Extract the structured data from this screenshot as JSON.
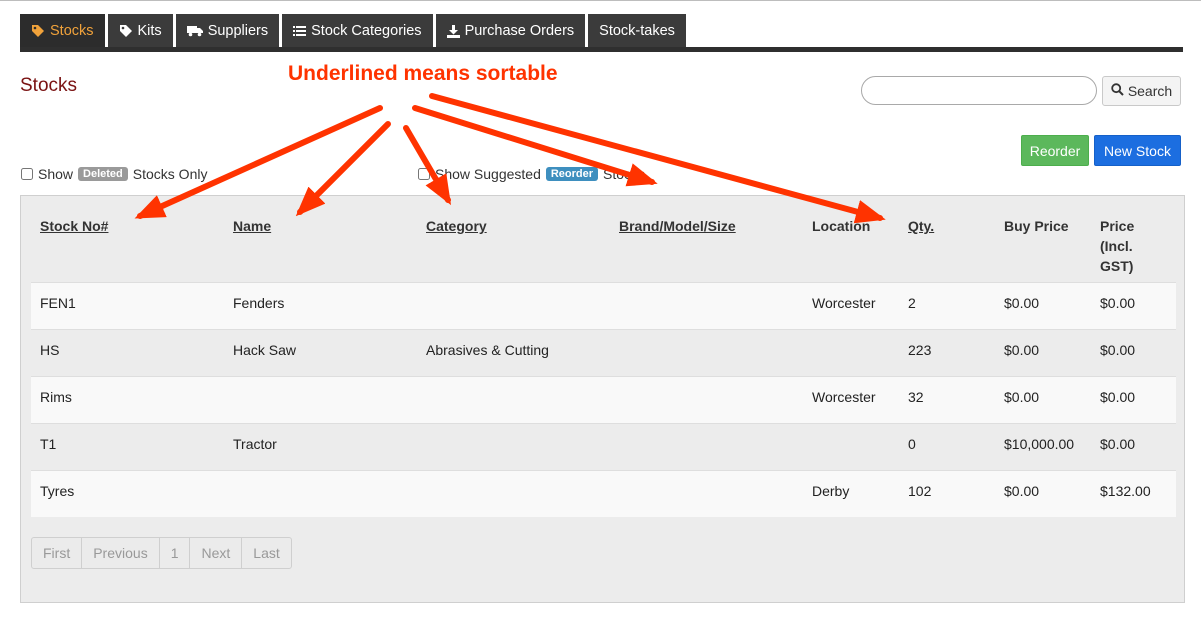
{
  "tabs": [
    {
      "label": "Stocks",
      "icon": "tags-icon",
      "active": true
    },
    {
      "label": "Kits",
      "icon": "tags-icon",
      "active": false
    },
    {
      "label": "Suppliers",
      "icon": "truck-icon",
      "active": false
    },
    {
      "label": "Stock Categories",
      "icon": "list-icon",
      "active": false
    },
    {
      "label": "Purchase Orders",
      "icon": "download-icon",
      "active": false
    },
    {
      "label": "Stock-takes",
      "icon": "",
      "active": false
    }
  ],
  "page": {
    "title": "Stocks"
  },
  "search": {
    "value": "",
    "button_label": "Search"
  },
  "actions": {
    "reorder_label": "Reorder",
    "new_stock_label": "New Stock"
  },
  "filters": {
    "deleted": {
      "prefix": "Show",
      "badge": "Deleted",
      "suffix": "Stocks Only"
    },
    "suggested": {
      "prefix": "Show Suggested",
      "badge": "Reorder",
      "suffix": "Stocks"
    }
  },
  "table": {
    "columns": [
      "Stock No#",
      "Name",
      "Category",
      "Brand/Model/Size",
      "Location",
      "Qty.",
      "Buy Price",
      "Price (Incl. GST)"
    ],
    "sortable": [
      true,
      true,
      true,
      true,
      false,
      true,
      false,
      false
    ],
    "rows": [
      [
        "FEN1",
        "Fenders",
        "",
        "",
        "Worcester",
        "2",
        "$0.00",
        "$0.00"
      ],
      [
        "HS",
        "Hack Saw",
        "Abrasives & Cutting",
        "",
        "",
        "223",
        "$0.00",
        "$0.00"
      ],
      [
        "Rims",
        "",
        "",
        "",
        "Worcester",
        "32",
        "$0.00",
        "$0.00"
      ],
      [
        "T1",
        "Tractor",
        "",
        "",
        "",
        "0",
        "$10,000.00",
        "$0.00"
      ],
      [
        "Tyres",
        "",
        "",
        "",
        "Derby",
        "102",
        "$0.00",
        "$132.00"
      ]
    ]
  },
  "pagination": {
    "first": "First",
    "previous": "Previous",
    "current": "1",
    "next": "Next",
    "last": "Last"
  },
  "annotation": {
    "text": "Underlined means sortable",
    "color": "#ff3300"
  },
  "colors": {
    "accent_active_tab": "#f0a23b",
    "title": "#7a1212",
    "reorder": "#5cb85c",
    "new_stock": "#1c6ee0"
  }
}
